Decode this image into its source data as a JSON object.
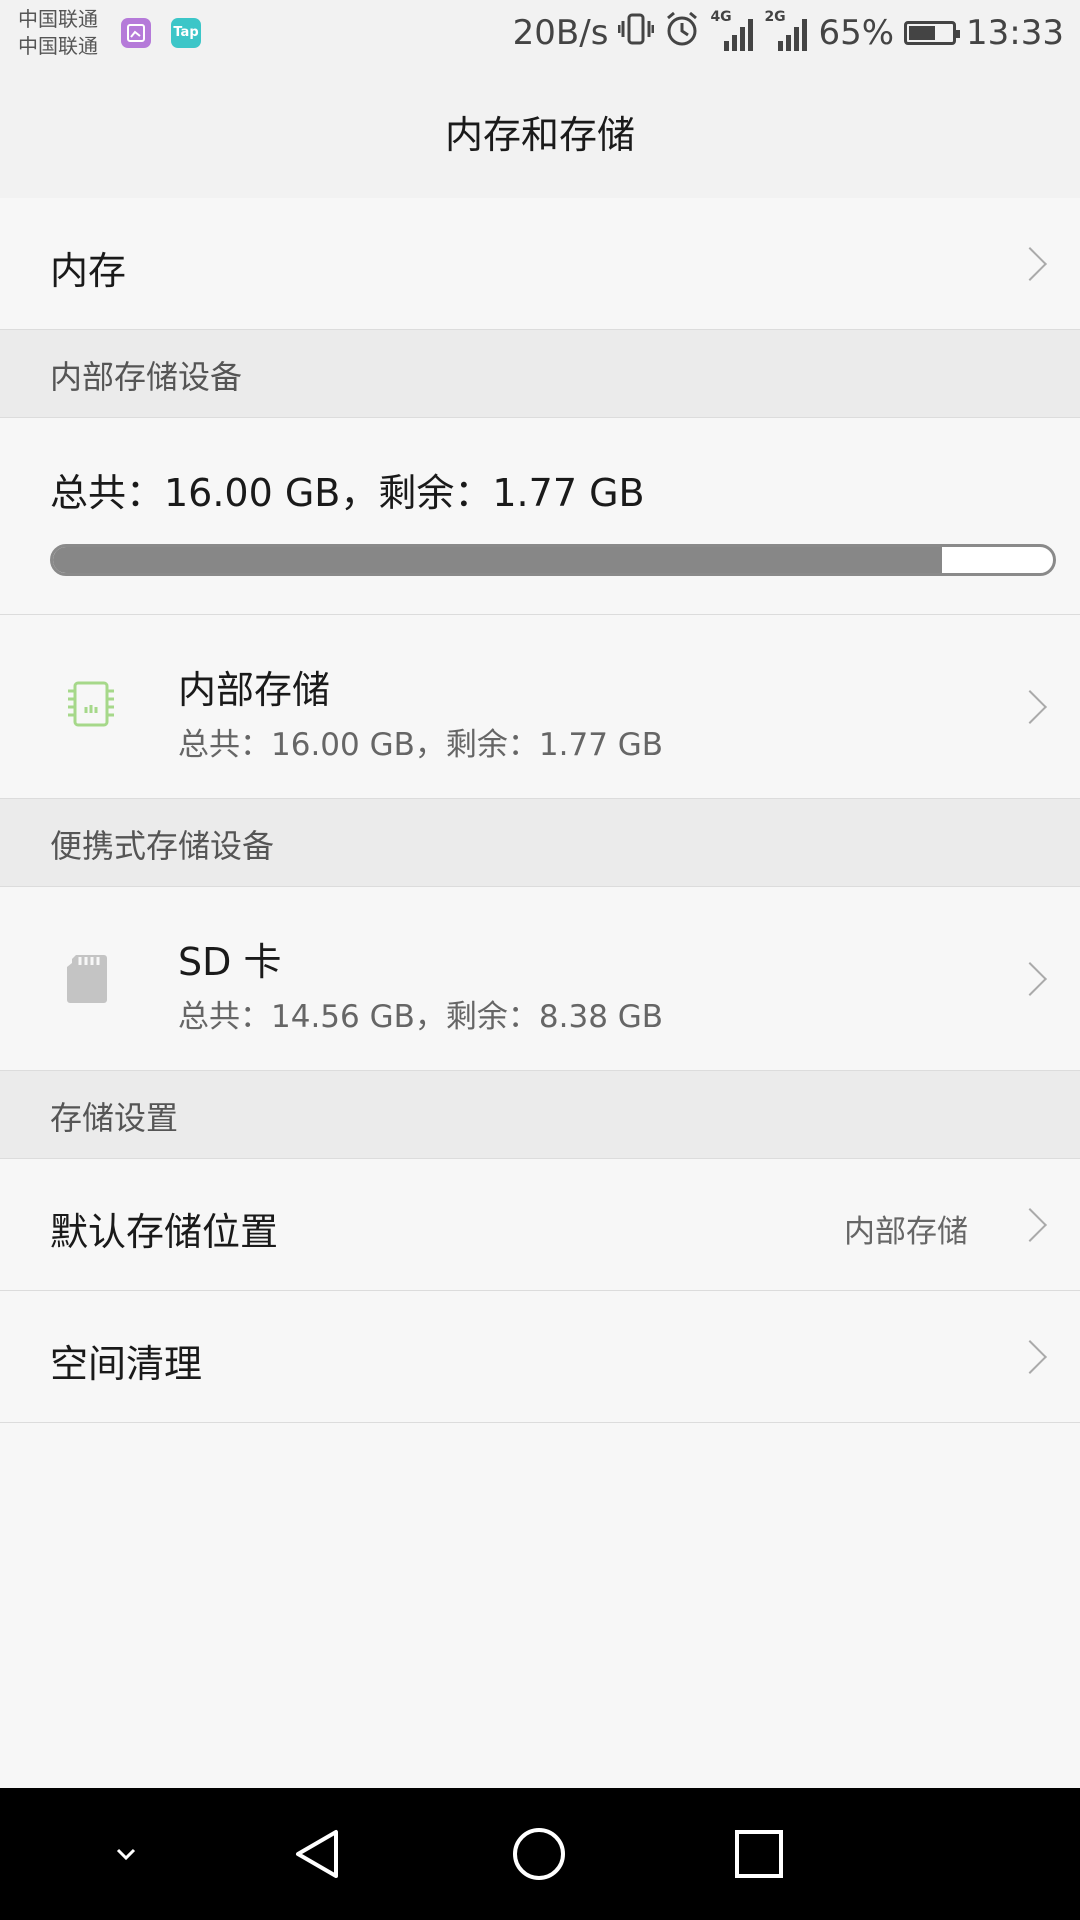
{
  "status_bar": {
    "carrier_1": "中国联通",
    "carrier_2": "中国联通",
    "tap_app_label": "Tap",
    "net_speed": "20B/s",
    "signal_1_gen": "4G",
    "signal_2_gen": "2G",
    "battery_percent": "65%",
    "battery_level": 0.65,
    "time": "13:33"
  },
  "header": {
    "title": "内存和存储"
  },
  "memory_row": {
    "label": "内存"
  },
  "internal_section": {
    "header": "内部存储设备",
    "usage_text": "总共：16.00 GB，剩余：1.77 GB",
    "used_fraction": 0.889,
    "device": {
      "name": "内部存储",
      "detail": "总共：16.00 GB，剩余：1.77 GB",
      "icon": "chip-icon",
      "icon_color": "#a6d88a"
    }
  },
  "portable_section": {
    "header": "便携式存储设备",
    "device": {
      "name": "SD 卡",
      "detail": "总共：14.56 GB，剩余：8.38 GB",
      "icon": "sd-card-icon"
    }
  },
  "settings_section": {
    "header": "存储设置",
    "default_location": {
      "label": "默认存储位置",
      "value": "内部存储"
    },
    "cleanup": {
      "label": "空间清理"
    }
  },
  "nav_bar": {
    "buttons": [
      "collapse",
      "back",
      "home",
      "recents"
    ]
  }
}
